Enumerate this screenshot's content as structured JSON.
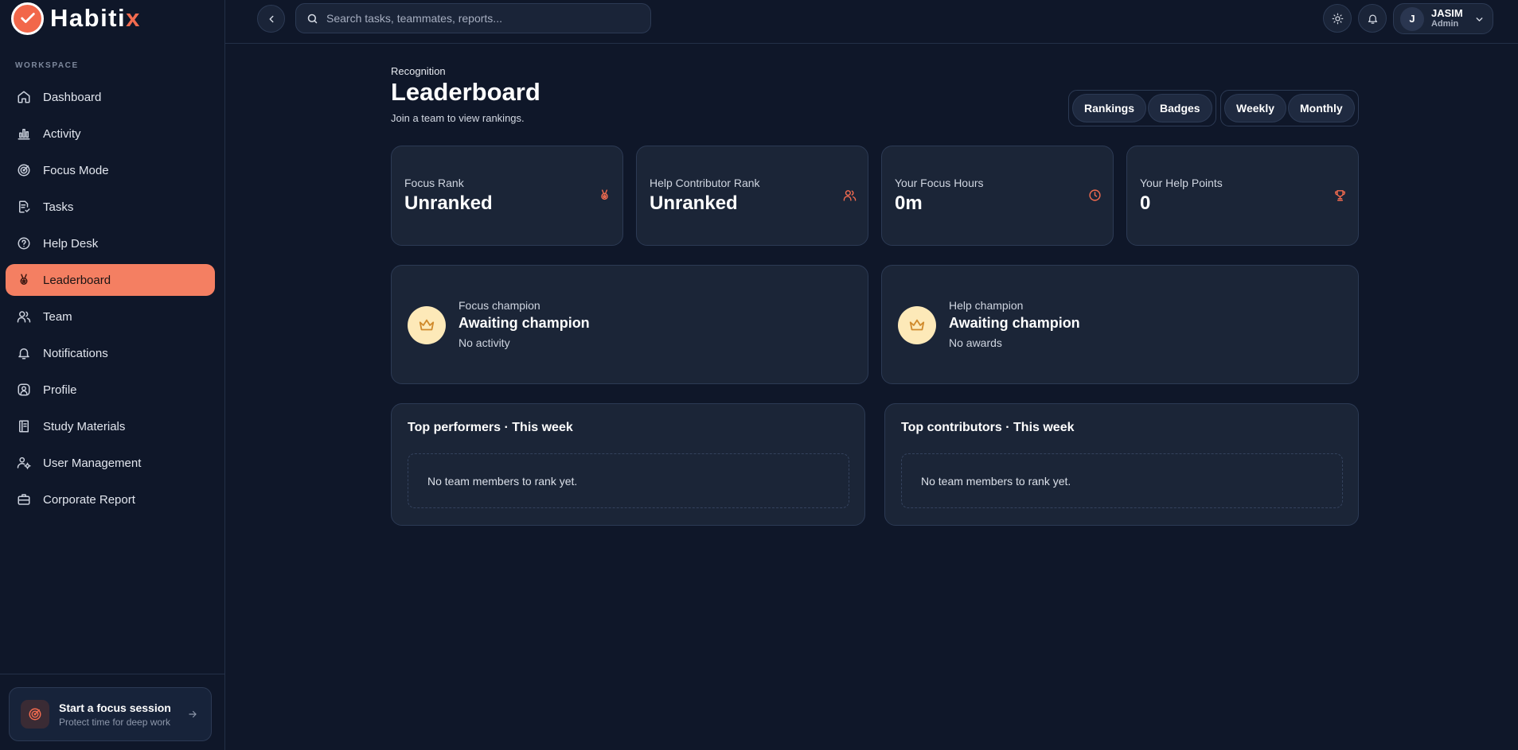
{
  "app": {
    "brand_main": "Habiti",
    "brand_accent": "x",
    "accent_color": "#f26b4f"
  },
  "sidebar": {
    "section_label": "WORKSPACE",
    "items": [
      {
        "label": "Dashboard",
        "icon": "home-icon"
      },
      {
        "label": "Activity",
        "icon": "bar-chart-icon"
      },
      {
        "label": "Focus Mode",
        "icon": "target-icon"
      },
      {
        "label": "Tasks",
        "icon": "clipboard-icon"
      },
      {
        "label": "Help Desk",
        "icon": "help-circle-icon"
      },
      {
        "label": "Leaderboard",
        "icon": "award-icon",
        "active": true
      },
      {
        "label": "Team",
        "icon": "users-icon"
      },
      {
        "label": "Notifications",
        "icon": "bell-icon"
      },
      {
        "label": "Profile",
        "icon": "user-circle-icon"
      },
      {
        "label": "Study Materials",
        "icon": "book-icon"
      },
      {
        "label": "User Management",
        "icon": "user-cog-icon"
      },
      {
        "label": "Corporate Report",
        "icon": "briefcase-icon"
      }
    ],
    "focus_cta": {
      "title": "Start a focus session",
      "subtitle": "Protect time for deep work"
    }
  },
  "topbar": {
    "search_placeholder": "Search tasks, teammates, reports...",
    "user": {
      "initial": "J",
      "name": "JASIM",
      "role": "Admin"
    }
  },
  "page": {
    "eyebrow": "Recognition",
    "title": "Leaderboard",
    "subtitle": "Join a team to view rankings.",
    "view_toggle": [
      "Rankings",
      "Badges"
    ],
    "period_toggle": [
      "Weekly",
      "Monthly"
    ]
  },
  "stats": [
    {
      "label": "Focus Rank",
      "value": "Unranked",
      "icon": "award-icon"
    },
    {
      "label": "Help Contributor Rank",
      "value": "Unranked",
      "icon": "users-icon"
    },
    {
      "label": "Your Focus Hours",
      "value": "0m",
      "icon": "clock-icon"
    },
    {
      "label": "Your Help Points",
      "value": "0",
      "icon": "trophy-icon"
    }
  ],
  "champions": [
    {
      "label": "Focus champion",
      "title": "Awaiting champion",
      "sub": "No activity"
    },
    {
      "label": "Help champion",
      "title": "Awaiting champion",
      "sub": "No awards"
    }
  ],
  "lists": [
    {
      "title": "Top performers · This week",
      "empty": "No team members to rank yet."
    },
    {
      "title": "Top contributors · This week",
      "empty": "No team members to rank yet."
    }
  ]
}
